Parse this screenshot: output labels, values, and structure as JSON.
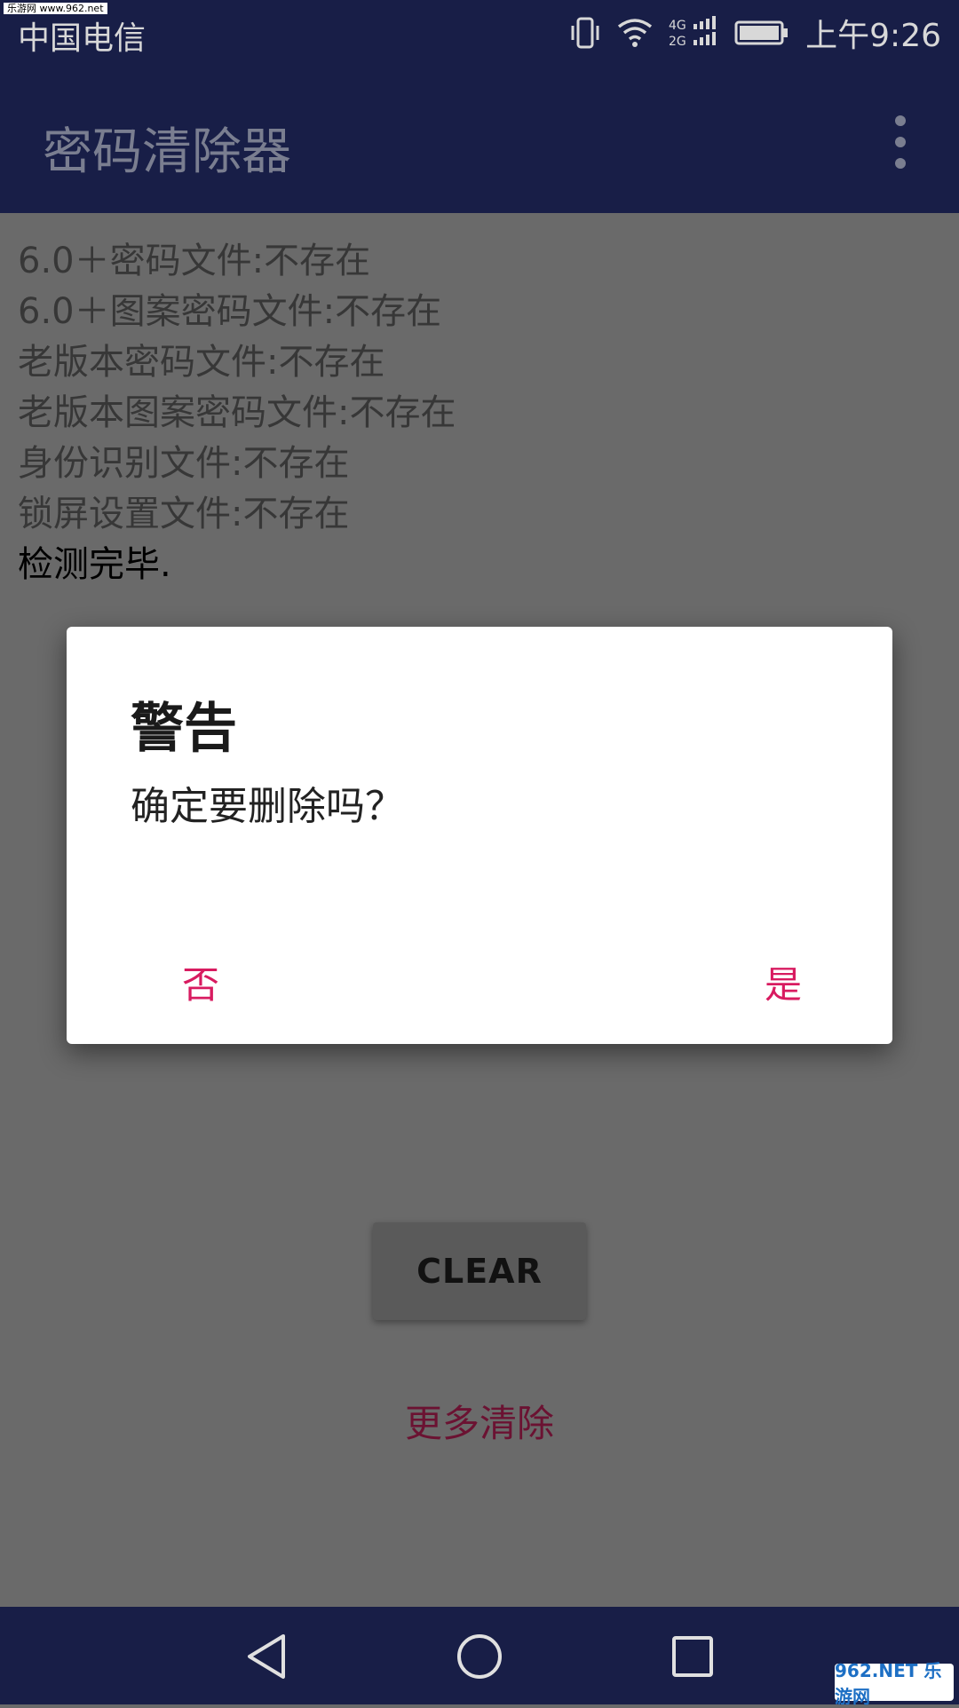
{
  "status_bar": {
    "watermark": "乐游网 www.962.net",
    "carrier": "中国电信",
    "time": "上午9:26",
    "icons": [
      "vibrate-icon",
      "wifi-icon",
      "signal-4g-2g-icon",
      "battery-icon"
    ]
  },
  "app_bar": {
    "title": "密码清除器",
    "overflow_icon": "more-vert-icon"
  },
  "log": {
    "lines": [
      "6.0＋密码文件:不存在",
      "6.0＋图案密码文件:不存在",
      "老版本密码文件:不存在",
      "老版本图案密码文件:不存在",
      "身份识别文件:不存在",
      "锁屏设置文件:不存在",
      "检测完毕."
    ]
  },
  "main": {
    "clear_label": "CLEAR",
    "more_clean_label": "更多清除"
  },
  "dialog": {
    "title": "警告",
    "message": "确定要删除吗？",
    "negative_label": "否",
    "positive_label": "是"
  },
  "nav_bar": {
    "icons": [
      "back-icon",
      "home-icon",
      "recents-icon"
    ],
    "watermark": "962.NET 乐游网"
  },
  "colors": {
    "bar_bg": "#181e47",
    "accent": "#d81b60",
    "scrim_bg": "#6a6a6a"
  }
}
